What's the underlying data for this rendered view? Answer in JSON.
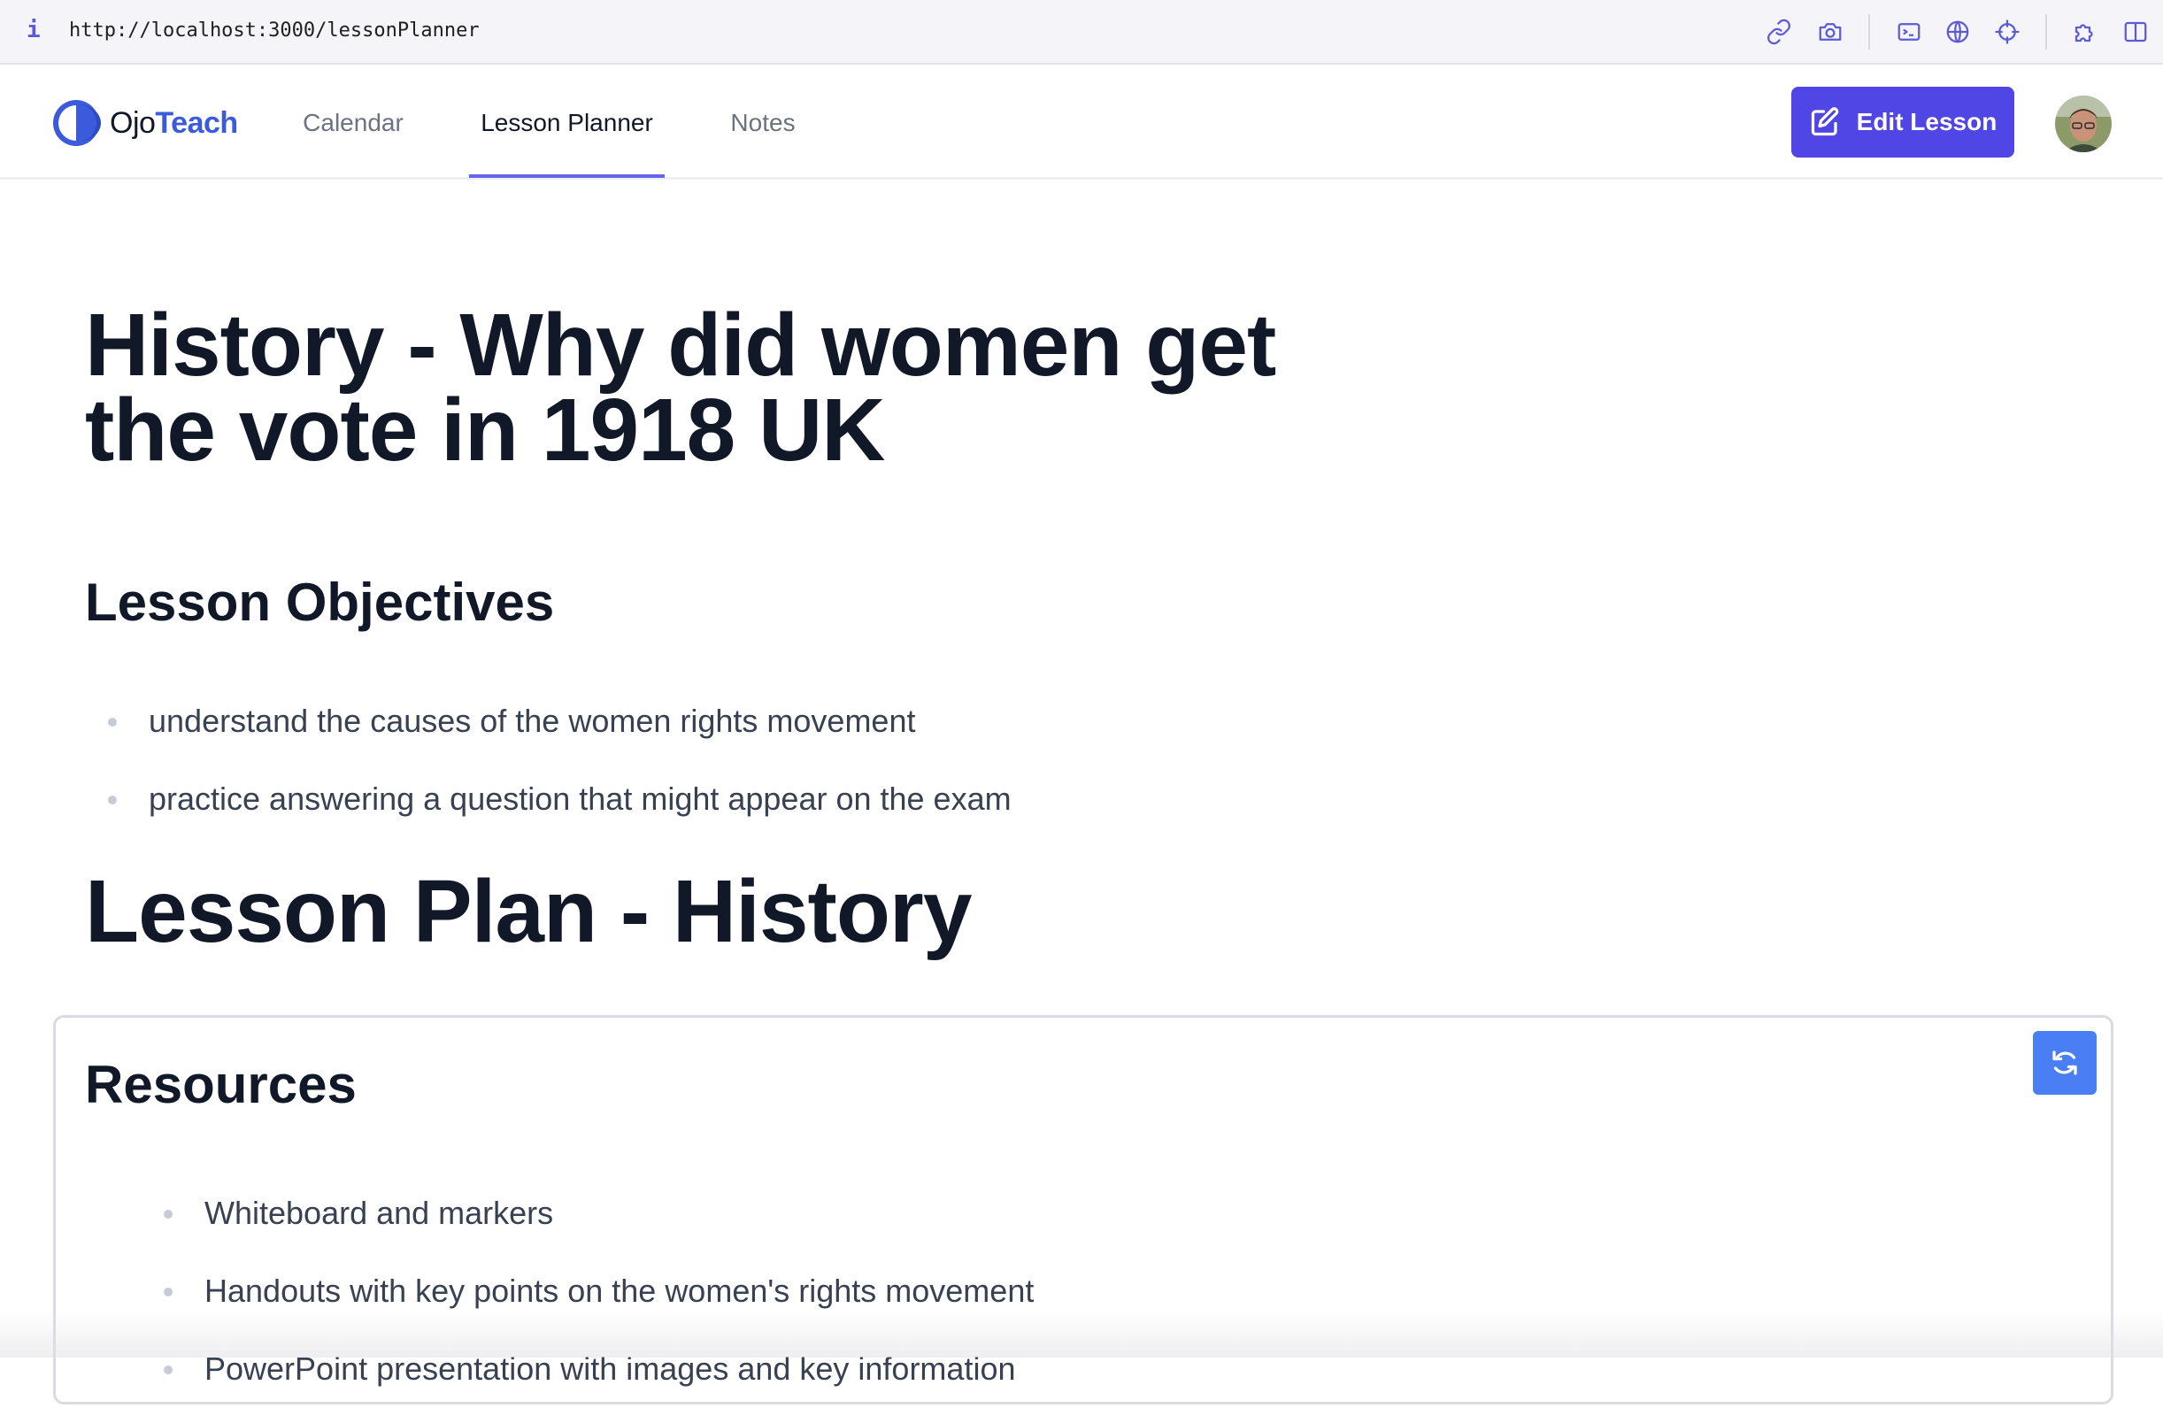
{
  "browser": {
    "info_glyph": "i",
    "url": "http://localhost:3000/lessonPlanner",
    "toolbar_icons": [
      "link-icon",
      "camera-icon",
      "terminal-icon",
      "globe-icon",
      "crosshair-icon",
      "puzzle-icon",
      "split-view-icon"
    ]
  },
  "navbar": {
    "brand_prefix": "Ojo",
    "brand_suffix": "Teach",
    "tabs": [
      {
        "label": "Calendar",
        "active": false
      },
      {
        "label": "Lesson Planner",
        "active": true
      },
      {
        "label": "Notes",
        "active": false
      }
    ],
    "edit_button_label": "Edit Lesson"
  },
  "lesson": {
    "title": "History - Why did women get the vote in 1918 UK",
    "objectives_heading": "Lesson Objectives",
    "objectives": [
      "understand the causes of the women rights movement",
      "practice answering a question that might appear on the exam"
    ],
    "plan_heading": "Lesson Plan - History",
    "resources_heading": "Resources",
    "resources": [
      "Whiteboard and markers",
      "Handouts with key points on the women's rights movement",
      "PowerPoint presentation with images and key information"
    ]
  },
  "colors": {
    "primary": "#4f46e5",
    "brand_blue": "#3b5bdb",
    "refresh_button": "#4a7ef5",
    "active_tab_underline": "#6366f1"
  }
}
